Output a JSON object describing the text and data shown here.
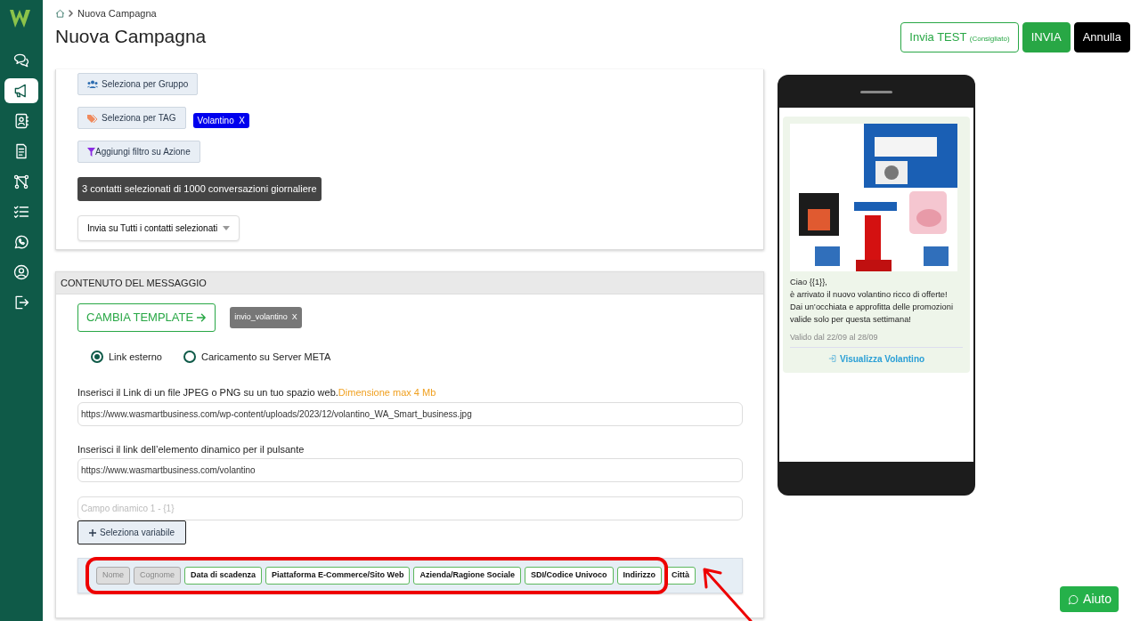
{
  "sidebar": {
    "items": [
      {
        "kind": "chat",
        "selected": false
      },
      {
        "kind": "megaphone",
        "selected": true
      },
      {
        "kind": "contacts",
        "selected": false
      },
      {
        "kind": "document",
        "selected": false
      },
      {
        "kind": "flow",
        "selected": false
      },
      {
        "kind": "checklist",
        "selected": false
      },
      {
        "kind": "whatsapp",
        "selected": false
      },
      {
        "kind": "user",
        "selected": false
      },
      {
        "kind": "logout",
        "selected": false
      }
    ]
  },
  "breadcrumb": {
    "items": [
      "Nuova Campagna"
    ]
  },
  "title": "Nuova Campagna",
  "header_buttons": [
    {
      "kind": "outline",
      "label": "Invia TEST",
      "note": "(Consigliato)"
    },
    {
      "kind": "primary",
      "label": "INVIA"
    },
    {
      "kind": "dark",
      "label": "Annulla"
    }
  ],
  "recipients": {
    "filters": [
      {
        "kind": "group",
        "label": "Seleziona per Gruppo"
      },
      {
        "kind": "tag",
        "label": "Seleziona per TAG",
        "tags": [
          {
            "label": "Volantino",
            "remove": "X"
          }
        ]
      },
      {
        "kind": "action",
        "label": "Aggiungi filtro su Azione"
      }
    ],
    "summary": "3 contatti selezionati di 1000 conversazioni giornaliere",
    "send_mode": "Invia su Tutti i contatti selezionati"
  },
  "message": {
    "header": "CONTENUTO DEL MESSAGGIO",
    "template_button": "CAMBIA TEMPLATE",
    "template_chip": {
      "label": "invio_volantino",
      "remove": "X"
    },
    "radios": [
      {
        "label": "Link esterno",
        "selected": true
      },
      {
        "label": "Caricamento su Server META",
        "selected": false
      }
    ],
    "image_link": {
      "label": "Inserisci il Link di un file JPEG o PNG su un tuo spazio web.",
      "note": "Dimensione max 4 Mb",
      "value": "https://www.wasmartbusiness.com/wp-content/uploads/2023/12/volantino_WA_Smart_business.jpg"
    },
    "button_link": {
      "label": "Inserisci il link dell’elemento dinamico per il pulsante",
      "value": "https://www.wasmartbusiness.com/volantino"
    },
    "dynamic_field": {
      "placeholder": "Campo dinamico 1 - {1}"
    },
    "select_variable": "Seleziona variabile",
    "variables": [
      {
        "label": "Nome",
        "disabled": true
      },
      {
        "label": "Cognome",
        "disabled": true
      },
      {
        "label": "Data di scadenza",
        "disabled": false
      },
      {
        "label": "Piattaforma E-Commerce/Sito Web",
        "disabled": false
      },
      {
        "label": "Azienda/Ragione Sociale",
        "disabled": false
      },
      {
        "label": "SDI/Codice Univoco",
        "disabled": false
      },
      {
        "label": "Indirizzo",
        "disabled": false
      },
      {
        "label": "Città",
        "disabled": false
      }
    ]
  },
  "preview": {
    "text": "Ciao {{1}},\nè arrivato il nuovo volantino ricco di offerte!\nDai un’occhiata e approfitta delle promozioni valide solo per questa settimana!",
    "validity": "Valido dal 22/09 al 28/09",
    "action": "Visualizza Volantino"
  },
  "help_button": "Aiuto"
}
